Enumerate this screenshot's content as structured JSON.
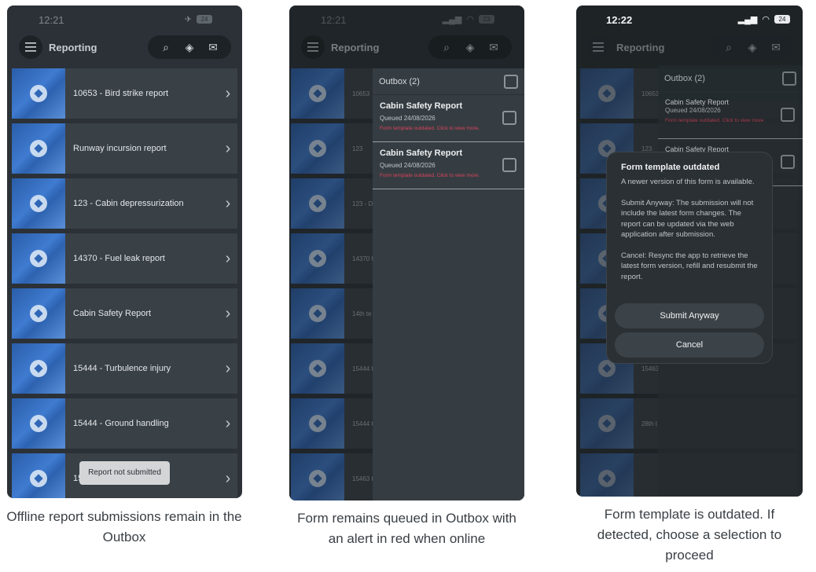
{
  "app_title": "Reporting",
  "screens": [
    {
      "time": "12:21",
      "battery": "24",
      "reports": [
        "10653 - Bird strike report",
        "Runway incursion report",
        "123 - Cabin depressurization",
        "14370 - Fuel leak report",
        "Cabin Safety Report",
        "15444 - Turbulence injury",
        "15444 - Ground handling",
        "15"
      ],
      "toast": "Report not submitted",
      "caption": "Offline report submissions remain in the Outbox"
    },
    {
      "time": "12:21",
      "battery": "23",
      "reports": [
        "10653",
        "123",
        "123 - D",
        "14370 f",
        "14th te",
        "15444 t",
        "15444 t",
        "15463 t"
      ],
      "outbox_title": "Outbox (2)",
      "outbox_items": [
        {
          "name": "Cabin Safety Report",
          "queued": "Queued 24/08/2026",
          "alert": "Form template outdated. Click to view more."
        },
        {
          "name": "Cabin Safety Report",
          "queued": "Queued 24/08/2026",
          "alert": "Form template outdated. Click to view more."
        }
      ],
      "caption": "Form remains queued in Outbox with an alert in red when online"
    },
    {
      "time": "12:22",
      "battery": "24",
      "reports": [
        "10653",
        "123",
        "",
        "",
        "",
        "15463",
        "28th t",
        ""
      ],
      "outbox_title": "Outbox (2)",
      "outbox_items": [
        {
          "name": "Cabin Safety Report",
          "queued": "Queued 24/08/2026",
          "alert": "Form template outdated. Click to view more."
        },
        {
          "name": "Cabin Safety Report",
          "queued": "",
          "alert": ""
        }
      ],
      "dialog": {
        "title": "Form template outdated",
        "p1": "A newer version of this form is available.",
        "p2": "Submit Anyway: The submission will not include the latest form changes. The report can be updated via the web application after submission.",
        "p3": "Cancel: Resync the app to retrieve the latest form version, refill and resubmit the report.",
        "submit": "Submit Anyway",
        "cancel": "Cancel"
      },
      "caption": "Form template is outdated. If detected, choose a selection to proceed"
    }
  ],
  "icons": [
    "menu-icon",
    "search-icon",
    "navigation-icon",
    "mail-icon",
    "chevron-right-icon",
    "app-logo-icon"
  ]
}
